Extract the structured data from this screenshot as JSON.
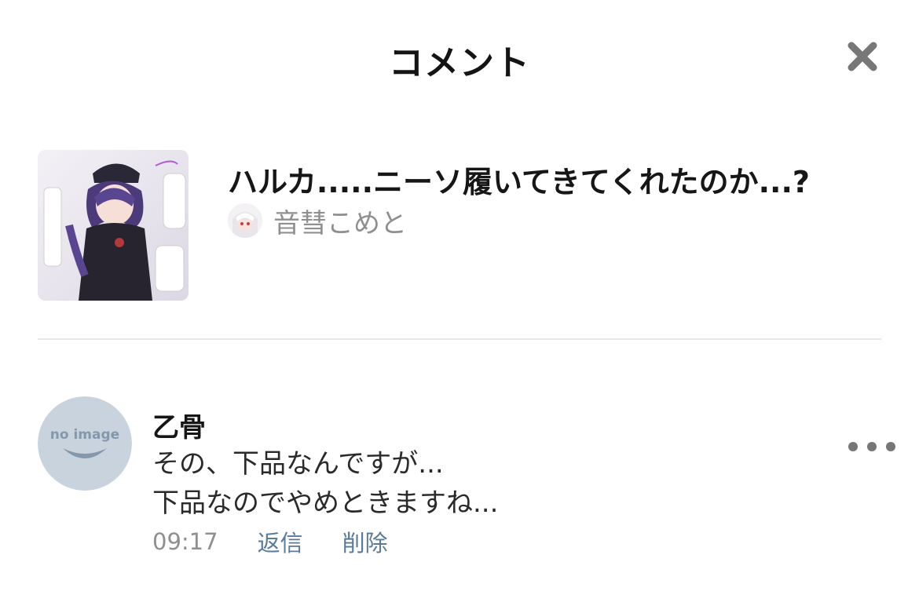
{
  "header": {
    "title": "コメント",
    "close_icon": "close-icon"
  },
  "post": {
    "thumbnail": "post-thumbnail-image",
    "title": "ハルカ.....ニーソ履いてきてくれたのか...?",
    "author": {
      "avatar": "author-avatar-image",
      "name": "音彗こめと"
    }
  },
  "comment": {
    "avatar_text": "no image",
    "user": "乙骨",
    "lines": [
      "その、下品なんですが...",
      "下品なのでやめときますね..."
    ],
    "time": "09:17",
    "reply_label": "返信",
    "delete_label": "削除",
    "more_icon": "more-horizontal-icon"
  },
  "colors": {
    "title_text": "#141414",
    "secondary_text": "#8f8f8f",
    "link_text": "#5a7a99",
    "divider": "#e6e6e6",
    "placeholder_avatar": "#c9d3de"
  }
}
